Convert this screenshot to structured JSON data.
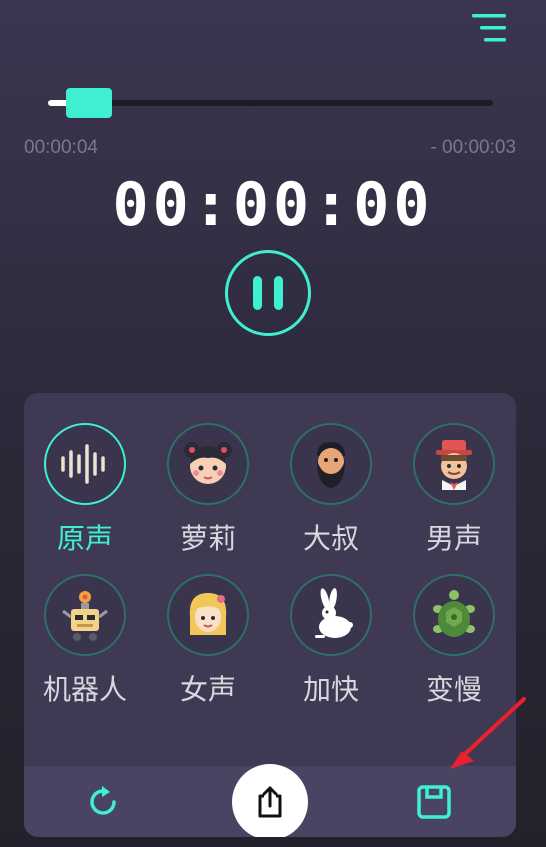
{
  "header": {
    "menu_icon": "menu-lines-icon"
  },
  "playback": {
    "elapsed": "00:00:04",
    "remaining": "- 00:00:03",
    "timer": "00:00:00",
    "progress": 0.05,
    "state_icon": "pause-icon"
  },
  "effects": [
    {
      "label": "原声",
      "icon": "soundwave-icon",
      "active": true
    },
    {
      "label": "萝莉",
      "icon": "girl-face-icon",
      "active": false
    },
    {
      "label": "大叔",
      "icon": "bearded-man-icon",
      "active": false
    },
    {
      "label": "男声",
      "icon": "man-hat-icon",
      "active": false
    },
    {
      "label": "机器人",
      "icon": "robot-icon",
      "active": false
    },
    {
      "label": "女声",
      "icon": "woman-face-icon",
      "active": false
    },
    {
      "label": "加快",
      "icon": "rabbit-icon",
      "active": false
    },
    {
      "label": "变慢",
      "icon": "turtle-icon",
      "active": false
    }
  ],
  "bottom_bar": {
    "reset_icon": "refresh-icon",
    "share_icon": "share-icon",
    "save_icon": "save-icon"
  },
  "colors": {
    "accent": "#3ff0d0",
    "panel": "#3f3953",
    "bottom_bar": "#4a4463",
    "annotation_arrow": "#e8212a"
  }
}
